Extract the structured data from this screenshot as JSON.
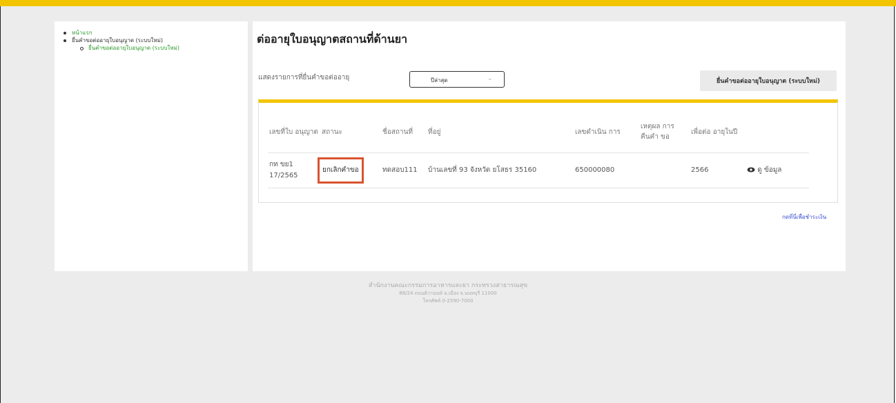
{
  "sidebar": {
    "items": [
      {
        "label": "หน้าแรก"
      },
      {
        "label": "ยื่นคำขอต่ออายุใบอนุญาต (ระบบใหม่)",
        "children": [
          {
            "label": "ยื่นคำขอต่ออายุใบอนุญาต (ระบบใหม่)"
          }
        ]
      }
    ]
  },
  "main": {
    "title": "ต่ออายุใบอนุญาตสถานที่ด้านยา",
    "filter_label": "แสดงรายการที่ยื่นคำขอต่ออายุ",
    "filter_value": "ปีล่าสุด",
    "new_button": "ยื่นคำขอต่ออายุใบอนุญาต (ระบบใหม่)",
    "pay_link": "กดที่นี่เพื่อชำระเงิน"
  },
  "table": {
    "headers": [
      "เลขที่ใบ อนุญาต",
      "สถานะ",
      "ชื่อสถานที่",
      "ที่อยู่",
      "เลขดำเนิน การ",
      "เหตุผล การคืนคำ ขอ",
      "เพื่อต่อ อายุในปี",
      ""
    ],
    "rows": [
      {
        "license_no": "กท ขย1 17/2565",
        "status": "ยกเลิกคำขอ",
        "place_name": "ทดสอบ111",
        "address": "บ้านเลขที่ 93 จังหวัด ยโสธร 35160",
        "process_no": "650000080",
        "return_reason": "",
        "renew_year": "2566",
        "view_label": "ดู ข้อมูล"
      }
    ]
  },
  "icons": {
    "view": "eye-icon",
    "dropdown": "chevron-down-icon"
  },
  "colors": {
    "accent_yellow": "#f2c500",
    "link_green": "#2e9b2e",
    "status_highlight": "#d9532f",
    "pay_link": "#3a4fd0"
  },
  "footer": {
    "line1": "สำนักงานคณะกรรมการอาหารและยา กระทรวงสาธารณสุข",
    "line2": "88/24 ถนนติวานนท์ อ.เมือง จ.นนทบุรี 11000",
    "line3": "โทรศัพท์ 0-2590-7000"
  }
}
